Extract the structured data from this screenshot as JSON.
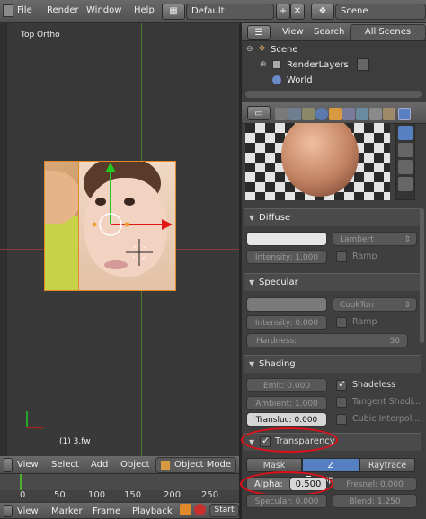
{
  "topbar": {
    "menu": [
      "File",
      "Render",
      "Window",
      "Help"
    ],
    "screen_layout": "Default",
    "scene": "Scene"
  },
  "viewport": {
    "view_name": "Top Ortho",
    "object_label": "(1) 3.fw"
  },
  "outliner": {
    "view": "View",
    "search": "Search",
    "display_mode": "All Scenes",
    "items": [
      "Scene",
      "RenderLayers",
      "World"
    ]
  },
  "material": {
    "diffuse": {
      "title": "Diffuse",
      "shader": "Lambert",
      "intensity": "Intensity: 1.000",
      "ramp": "Ramp"
    },
    "specular": {
      "title": "Specular",
      "shader": "CookTorr",
      "intensity": "Intensity: 0.000",
      "ramp": "Ramp",
      "hardness_label": "Hardness:",
      "hardness_value": "50"
    },
    "shading": {
      "title": "Shading",
      "emit": "Emit: 0.000",
      "ambient": "Ambient: 1.000",
      "transluc": "Transluc: 0.000",
      "shadeless": "Shadeless",
      "tangent": "Tangent Shadi...",
      "cubic": "Cubic Interpol..."
    },
    "transparency": {
      "title": "Transparency",
      "tabs": [
        "Mask",
        "Z Transpare...",
        "Raytrace"
      ],
      "alpha_label": "Alpha:",
      "alpha_value": "0.500",
      "fresnel": "Fresnel: 0.000",
      "specular": "Specular: 0.000",
      "blend": "Blend: 1.250"
    }
  },
  "view3d_header": {
    "menu": [
      "View",
      "Select",
      "Add",
      "Object"
    ],
    "mode": "Object Mode"
  },
  "timeline": {
    "ticks": [
      "0",
      "50",
      "100",
      "150",
      "200",
      "250"
    ],
    "menu": [
      "View",
      "Marker",
      "Frame",
      "Playback"
    ],
    "start": "Start"
  },
  "colors": {
    "accent_blue": "#5680c2",
    "annotation_red": "#e0101a",
    "gizmo_green": "#22c822",
    "gizmo_red": "#e01818"
  }
}
